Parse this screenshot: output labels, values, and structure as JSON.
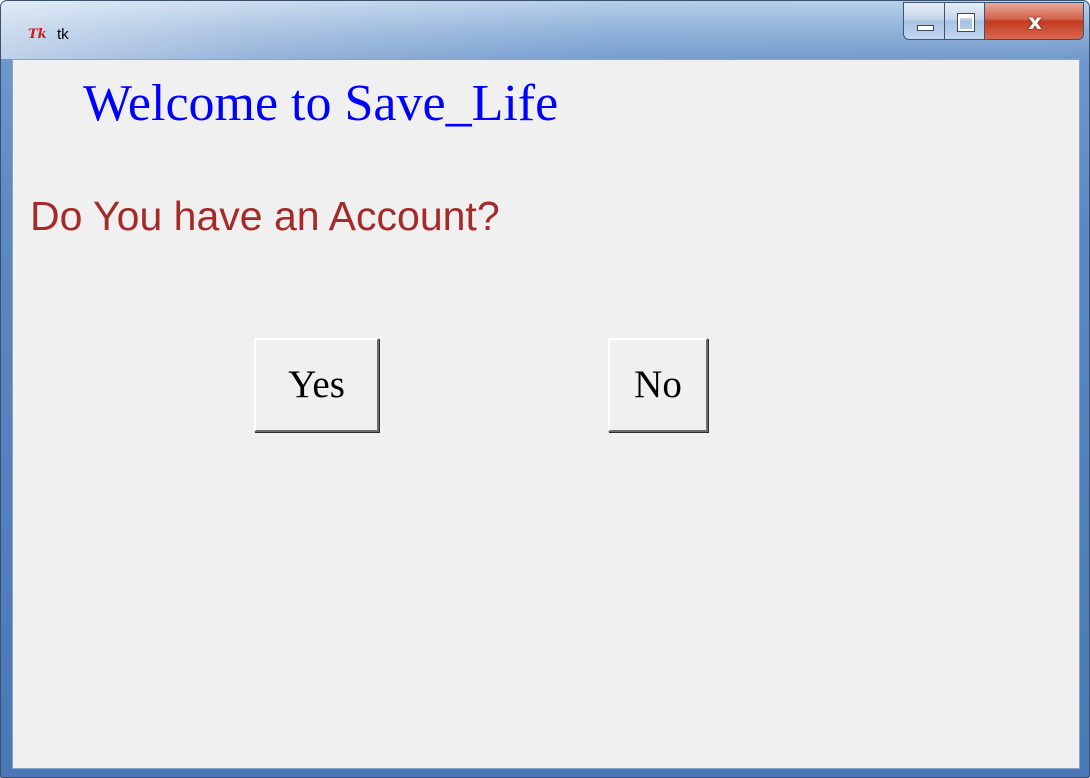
{
  "window": {
    "title": "tk",
    "app_icon_text": "Tk",
    "icon": "tk-feather-icon",
    "controls": {
      "minimize_icon": "minimize-icon",
      "maximize_icon": "maximize-icon",
      "close_icon": "close-icon",
      "close_glyph": "x"
    },
    "colors": {
      "frame_accent": "#5b88c2",
      "close_button": "#c23a1f",
      "client_background": "#f0f0f0"
    }
  },
  "content": {
    "welcome_text": "Welcome to Save_Life",
    "question_text": "Do You have an Account?",
    "yes_label": "Yes",
    "no_label": "No",
    "colors": {
      "welcome": "#0000ff",
      "question": "#a52a2a",
      "button_text": "#000000"
    }
  }
}
